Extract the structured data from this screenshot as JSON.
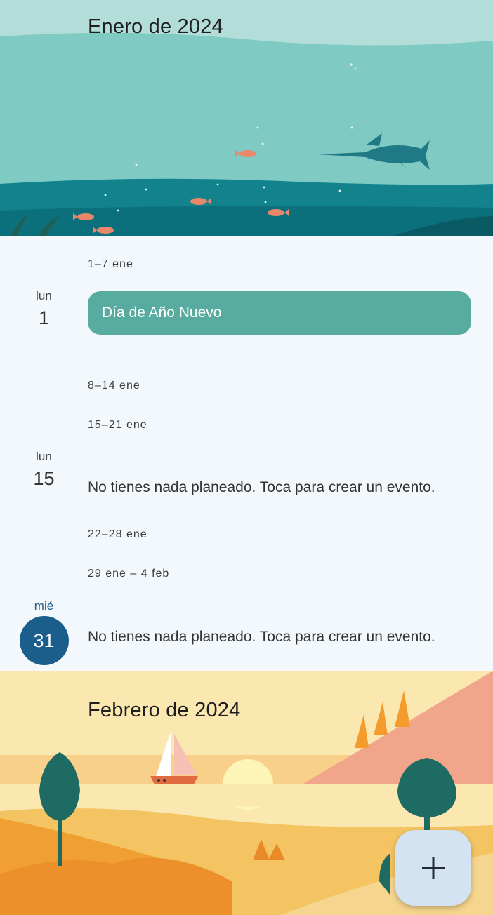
{
  "months": {
    "january": {
      "title": "Enero de 2024"
    },
    "february": {
      "title": "Febrero de 2024"
    }
  },
  "agenda": {
    "weeks": [
      {
        "range": "1–7 ene"
      },
      {
        "range": "8–14 ene"
      },
      {
        "range": "15–21 ene"
      },
      {
        "range": "22–28 ene"
      },
      {
        "range": "29 ene – 4 feb"
      }
    ],
    "days": [
      {
        "dow": "lun",
        "num": "1"
      },
      {
        "dow": "lun",
        "num": "15"
      },
      {
        "dow": "mié",
        "num": "31",
        "today": true
      }
    ],
    "event_new_year": "Día de Año Nuevo",
    "empty_message": "No tienes nada planeado. Toca para crear un evento."
  },
  "fab": {
    "icon": "plus-icon"
  },
  "colors": {
    "event_chip": "#57ab9f",
    "today_circle": "#1b5e8c",
    "fab_bg": "#d3e3f1",
    "background": "#f3f8fc"
  }
}
